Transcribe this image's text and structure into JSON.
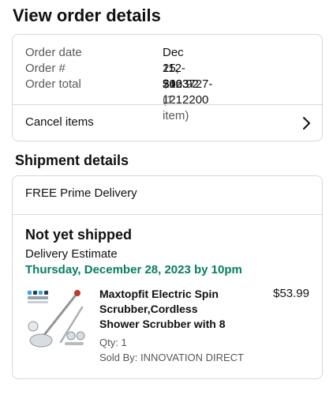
{
  "page": {
    "title": "View order details"
  },
  "summary": {
    "order_date_label": "Order date",
    "order_date": "Dec 25, 2023",
    "order_number_label": "Order #",
    "order_number": "112-5103727-1212200",
    "order_total_label": "Order total",
    "order_total": "$46.92",
    "item_count": "(1 item)",
    "cancel_label": "Cancel items",
    "cancel_icon": "chevron-right-icon"
  },
  "shipment": {
    "section_title": "Shipment details",
    "delivery_type": "FREE Prime Delivery",
    "status": "Not yet shipped",
    "estimate_label": "Delivery Estimate",
    "estimate_date": "Thursday, December 28, 2023 by 10pm",
    "estimate_color": "#067d62",
    "item": {
      "title_line1": "Maxtopfit Electric Spin",
      "title_line2": "Scrubber,Cordless",
      "title_line3": "Shower Scrubber with 8",
      "price": "$53.99",
      "qty": "Qty: 1",
      "sold_by": "Sold By: INNOVATION DIRECT"
    }
  }
}
